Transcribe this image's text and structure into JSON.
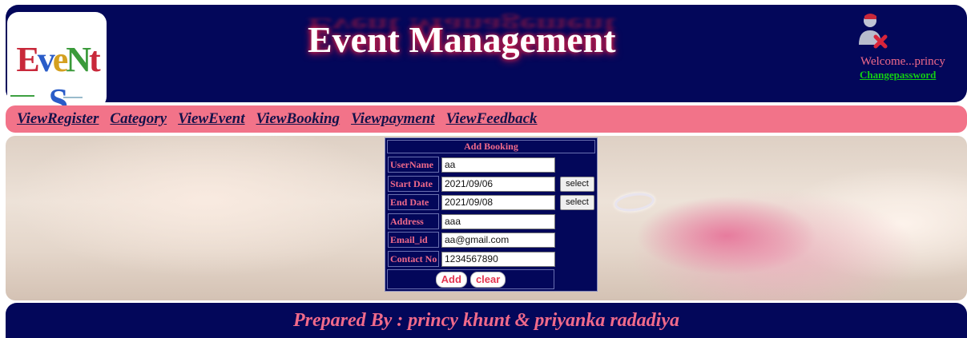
{
  "header": {
    "logo_text": "EveNtS",
    "title": "Event Management",
    "welcome": "Welcome...princy",
    "change_password": "Changepassword"
  },
  "nav": {
    "items": [
      "ViewRegister",
      "Category",
      "ViewEvent",
      "ViewBooking",
      "Viewpayment",
      "ViewFeedback"
    ]
  },
  "form": {
    "title": "Add Booking",
    "fields": [
      {
        "label": "UserName",
        "value": "aa"
      },
      {
        "label": "Start Date",
        "value": "2021/09/06",
        "button": "select"
      },
      {
        "label": "End Date",
        "value": "2021/09/08",
        "button": "select"
      },
      {
        "label": "Address",
        "value": "aaa"
      },
      {
        "label": "Email_id",
        "value": "aa@gmail.com"
      },
      {
        "label": "Contact No",
        "value": "1234567890"
      }
    ],
    "add_label": "Add",
    "clear_label": "clear"
  },
  "footer": {
    "text": "Prepared By : princy khunt & priyanka radadiya"
  },
  "colors": {
    "navy": "#03075a",
    "pink_nav": "#f27389",
    "label_pink": "#f06a8a",
    "link_green": "#12d012"
  },
  "icons": {
    "user": "user-remove-icon"
  }
}
